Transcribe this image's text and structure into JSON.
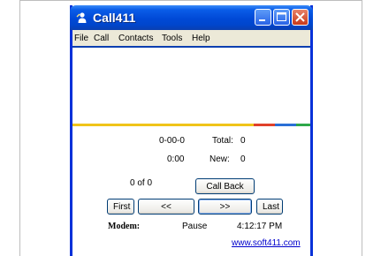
{
  "window": {
    "title": "Call411"
  },
  "menu": [
    "File",
    "Call",
    "Contacts",
    "Tools",
    "Help"
  ],
  "colors": {
    "strip_yellow": "#f0c419",
    "strip_red": "#e0402a",
    "strip_blue": "#2a6fd6",
    "strip_green": "#2ea84a"
  },
  "stats": {
    "number": "0-00-0",
    "total_label": "Total:",
    "total_value": "0",
    "duration": "0:00",
    "new_label": "New:",
    "new_value": "0"
  },
  "nav": {
    "position": "0 of 0",
    "callback_label": "Call Back",
    "first_label": "First",
    "prev_label": "<<",
    "next_label": ">>",
    "last_label": "Last"
  },
  "status": {
    "modem_label": "Modem:",
    "modem_state": "Pause",
    "time": "4:12:17 PM",
    "website": "www.soft411.com"
  }
}
